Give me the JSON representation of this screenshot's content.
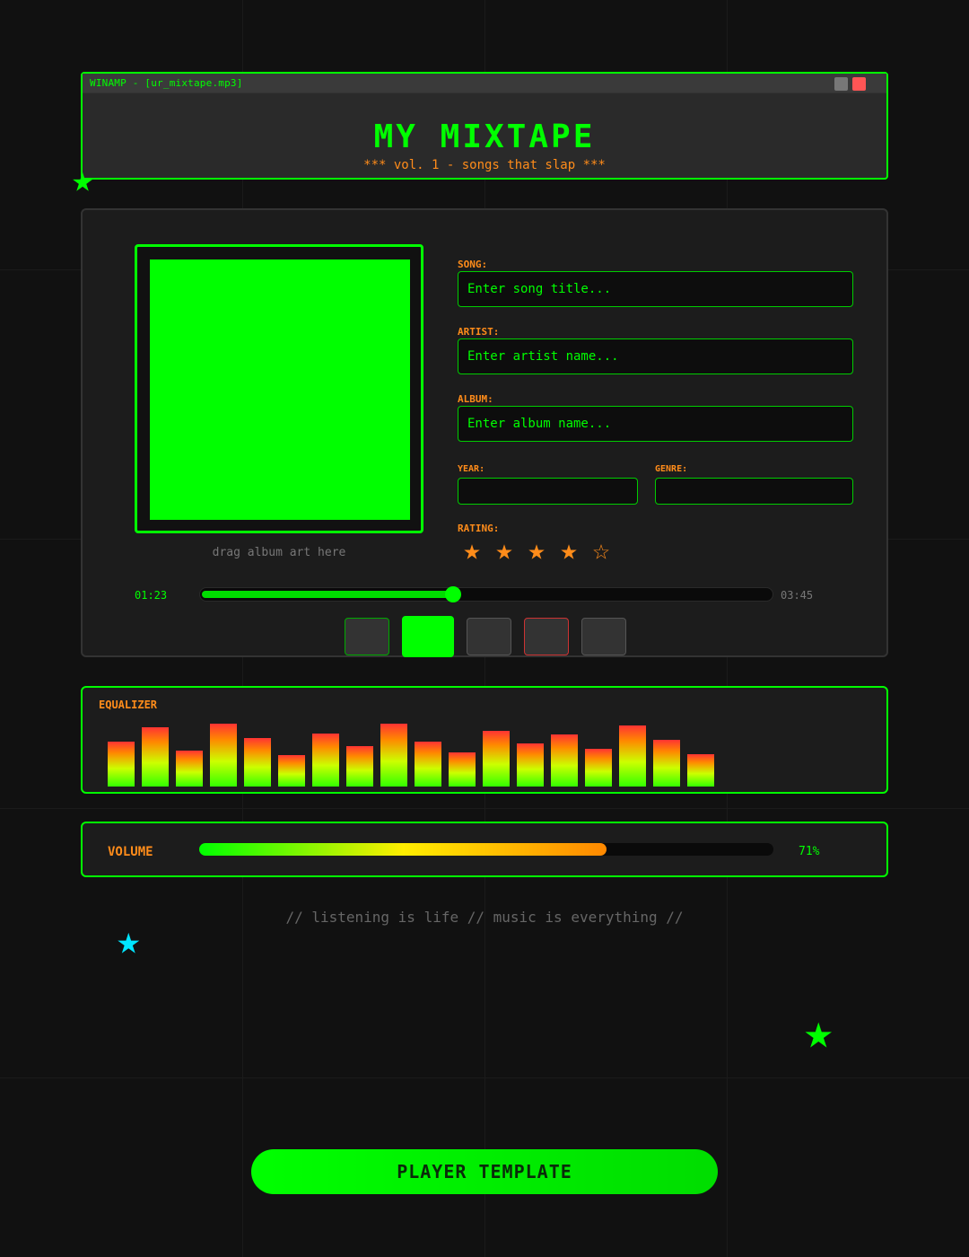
{
  "window": {
    "bar_title": "WINAMP - [ur_mixtape.mp3]",
    "title": "MY MIXTAPE",
    "subtitle": "*** vol. 1 - songs that slap ***"
  },
  "album_art": {
    "hint": "drag album art here"
  },
  "form": {
    "song": {
      "label": "SONG:",
      "placeholder": "Enter song title..."
    },
    "artist": {
      "label": "ARTIST:",
      "placeholder": "Enter artist name..."
    },
    "album": {
      "label": "ALBUM:",
      "placeholder": "Enter album name..."
    },
    "year": {
      "label": "YEAR:"
    },
    "genre": {
      "label": "GENRE:"
    },
    "rating": {
      "label": "RATING:",
      "value": 4,
      "max": 5,
      "filled_glyph": "★",
      "empty_glyph": "☆"
    }
  },
  "playback": {
    "current_time": "01:23",
    "total_time": "03:45",
    "progress_fraction": 0.44
  },
  "controls": [
    "prev-button",
    "play-button",
    "pause-button",
    "stop-button",
    "next-button"
  ],
  "equalizer": {
    "label": "EQUALIZER",
    "levels": [
      0.62,
      0.82,
      0.5,
      0.88,
      0.68,
      0.44,
      0.74,
      0.56,
      0.88,
      0.62,
      0.48,
      0.78,
      0.6,
      0.72,
      0.52,
      0.85,
      0.65,
      0.45
    ]
  },
  "volume": {
    "label": "VOLUME",
    "value_text": "71%",
    "fraction": 0.71
  },
  "footer": {
    "quote": "// listening is life // music is everything //"
  },
  "cta": {
    "label": "PLAYER TEMPLATE"
  },
  "colors": {
    "primary": "#00ff00",
    "accent": "#ff8c1a",
    "cyan": "#00e5ff",
    "background": "#111111"
  }
}
